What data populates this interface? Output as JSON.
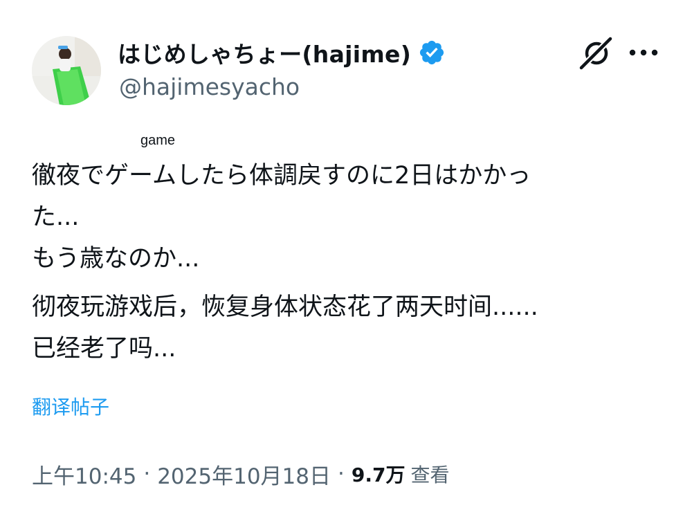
{
  "tweet": {
    "author": {
      "display_name": "はじめしゃちょー(hajime)",
      "username": "@hajimesyacho",
      "verified": true,
      "avatar_icon": "avatar-photo"
    },
    "header_actions": {
      "grok_icon": "grok-icon",
      "more_icon": "more-dots-icon"
    },
    "ruby_annotation": "game",
    "text_lines": [
      "徹夜でゲームしたら体調戻すのに2日はかかっ",
      "た...",
      "もう歳なのか..."
    ],
    "translated_lines": [
      "彻夜玩游戏后，恢复身体状态花了两天时间......",
      "已经老了吗..."
    ],
    "translate_link": "翻译帖子",
    "meta": {
      "time": "上午10:45",
      "separator": "·",
      "date": "2025年10月18日",
      "views_count": "9.7万",
      "views_label": "查看"
    }
  },
  "colors": {
    "primary_text": "#0f1419",
    "secondary_text": "#536471",
    "link_blue": "#1d9bf0",
    "verified_blue": "#1d9bf0"
  }
}
